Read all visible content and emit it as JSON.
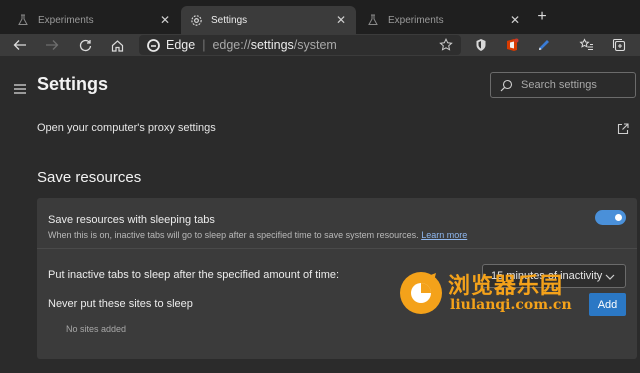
{
  "tabs": [
    {
      "label": "Experiments",
      "active": false
    },
    {
      "label": "Settings",
      "active": true
    },
    {
      "label": "Experiments",
      "active": false
    }
  ],
  "toolbar": {
    "brand": "Edge",
    "url_prefix": "edge://",
    "url_strong": "settings",
    "url_suffix": "/system"
  },
  "settings": {
    "title": "Settings",
    "search_placeholder": "Search settings",
    "proxy_label": "Open your computer's proxy settings",
    "section_title": "Save resources",
    "sleeping_tabs": {
      "title": "Save resources with sleeping tabs",
      "description": "When this is on, inactive tabs will go to sleep after a specified time to save system resources.",
      "learn_more": "Learn more",
      "enabled": true
    },
    "sleep_after": {
      "label": "Put inactive tabs to sleep after the specified amount of time:",
      "selected": "15 minutes of inactivity"
    },
    "never_sleep": {
      "label": "Never put these sites to sleep",
      "add_label": "Add",
      "empty_text": "No sites added"
    }
  },
  "watermark": {
    "cn_text": "浏览器乐园",
    "url_text": "liulanqi.com.cn"
  },
  "colors": {
    "accent": "#2b78c5",
    "toggle_on": "#4a90d9",
    "watermark": "#f4a21a"
  }
}
